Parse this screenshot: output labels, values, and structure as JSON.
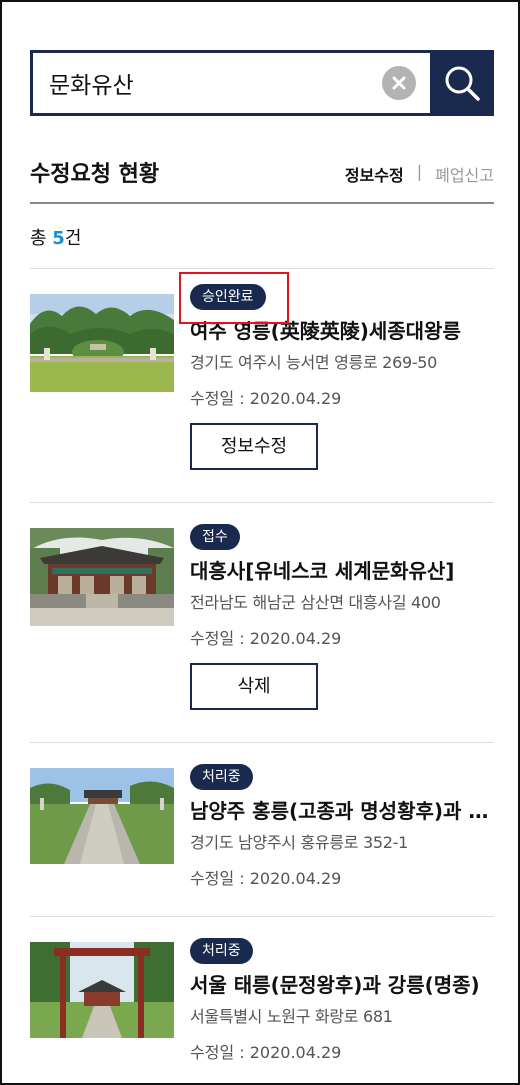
{
  "search": {
    "value": "문화유산"
  },
  "heading": {
    "title": "수정요청 현황",
    "tab_active": "정보수정",
    "tab_separator": "|",
    "tab_inactive": "폐업신고"
  },
  "count": {
    "prefix": "총 ",
    "number": "5",
    "suffix": "건"
  },
  "items": [
    {
      "badge": "승인완료",
      "title": "여주 영릉(英陵英陵)세종대왕릉",
      "address": "경기도 여주시 능서면 영릉로 269-50",
      "date": "수정일 : 2020.04.29",
      "action": "정보수정"
    },
    {
      "badge": "접수",
      "title": "대흥사[유네스코 세계문화유산]",
      "address": "전라남도 해남군 삼산면 대흥사길 400",
      "date": "수정일 : 2020.04.29",
      "action": "삭제"
    },
    {
      "badge": "처리중",
      "title": "남양주 홍릉(고종과 명성황후)과 유릉",
      "address": "경기도 남양주시 홍유릉로 352-1",
      "date": "수정일 : 2020.04.29"
    },
    {
      "badge": "처리중",
      "title": "서울 태릉(문정왕후)과 강릉(명종)",
      "address": "서울특별시 노원구 화랑로 681",
      "date": "수정일 : 2020.04.29"
    }
  ],
  "colors": {
    "navy": "#1a2a4f",
    "accent_blue": "#1a8fd2",
    "highlight_red": "#e0141e"
  },
  "icons": {
    "clear": "clear-icon",
    "search": "search-icon"
  }
}
